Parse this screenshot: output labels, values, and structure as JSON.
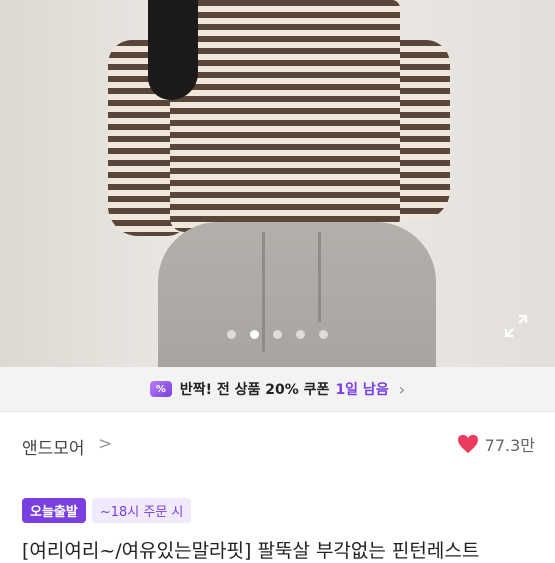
{
  "photo": {
    "image_description": "",
    "dot_count": 5,
    "active_dot_index": 1
  },
  "coupon": {
    "icon_glyph": "%",
    "text": "반짝! 전 상품 20% 쿠폰",
    "deadline": "1일 남음",
    "chevron": "›"
  },
  "seller": {
    "name": "앤드모어",
    "chevron": ">",
    "likes": "77.3만"
  },
  "badges": {
    "today_shipping": "오늘출발",
    "order_cutoff": "~18시 주문 시"
  },
  "product": {
    "title": "[여리여리~/여유있는말라핏] 팔뚝살 부각없는 핀턴레스트"
  },
  "colors": {
    "accent": "#7a3fe0",
    "heart": "#ec3b5c"
  },
  "icons": {
    "expand": "expand-icon",
    "heart": "heart-icon",
    "coupon": "coupon-percent-icon"
  }
}
